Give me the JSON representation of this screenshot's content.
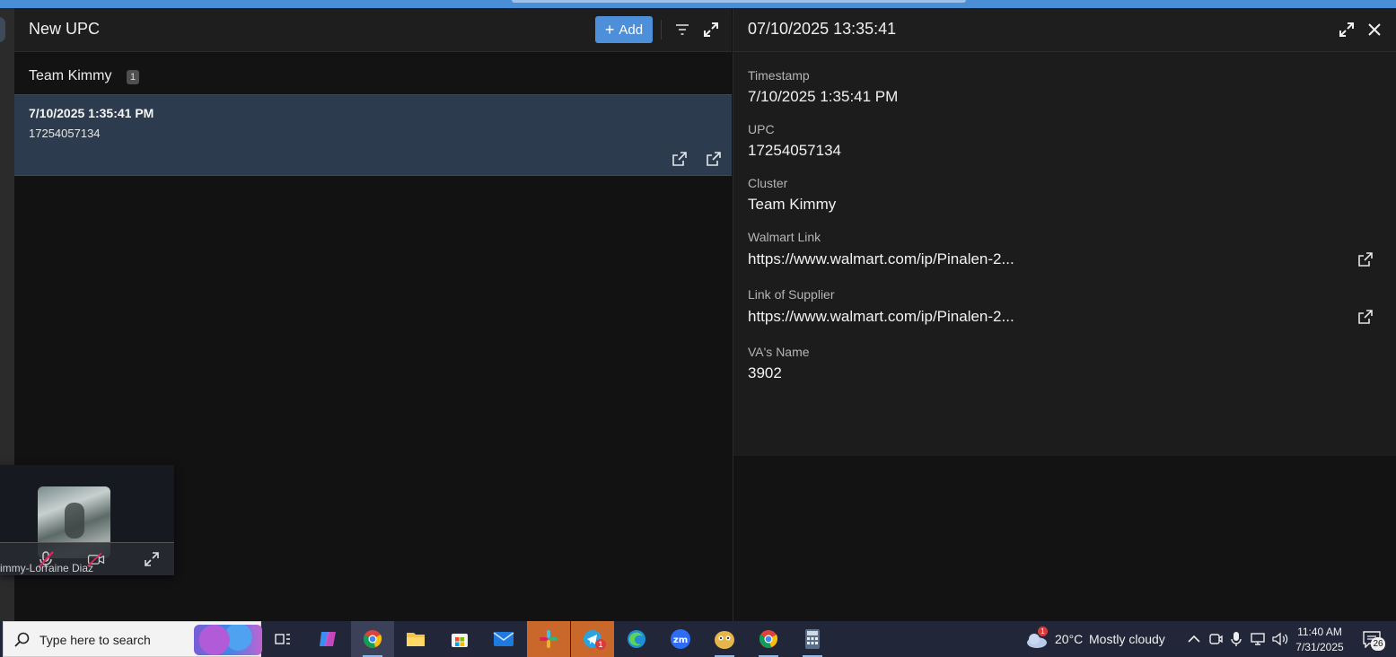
{
  "left_panel": {
    "title": "New UPC",
    "add_label": "Add",
    "group": {
      "label": "Team Kimmy",
      "count": "1"
    },
    "rows": [
      {
        "timestamp": "7/10/2025 1:35:41 PM",
        "upc": "17254057134"
      }
    ]
  },
  "detail": {
    "title": "07/10/2025 13:35:41",
    "fields": {
      "timestamp": {
        "label": "Timestamp",
        "value": "7/10/2025 1:35:41 PM"
      },
      "upc": {
        "label": "UPC",
        "value": "17254057134"
      },
      "cluster": {
        "label": "Cluster",
        "value": "Team Kimmy"
      },
      "walmart_link": {
        "label": "Walmart Link",
        "value": "https://www.walmart.com/ip/Pinalen-2..."
      },
      "supplier_link": {
        "label": "Link of Supplier",
        "value": "https://www.walmart.com/ip/Pinalen-2..."
      },
      "va_name": {
        "label": "VA's Name",
        "value": "3902"
      }
    }
  },
  "video_call": {
    "participant": "immy-Lorraine Diaz"
  },
  "taskbar": {
    "search_placeholder": "Type here to search",
    "weather": {
      "temp": "20°C",
      "condition": "Mostly cloudy",
      "badge": "1"
    },
    "telegram_badge": "1",
    "clock": {
      "time": "11:40 AM",
      "date": "7/31/2025"
    },
    "notification_count": "26"
  },
  "colors": {
    "accent": "#4d8fd9",
    "selected_row": "#2c3b4d",
    "topbar": "#4a8fd6"
  }
}
